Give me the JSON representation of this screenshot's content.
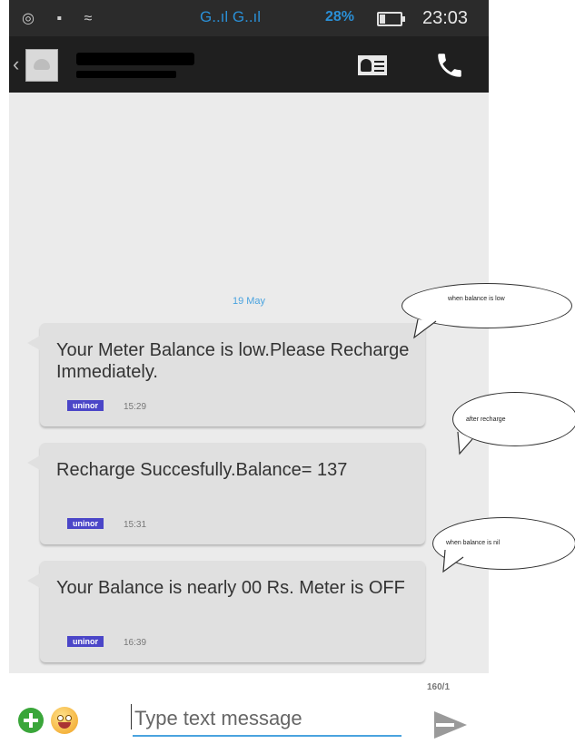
{
  "status_bar": {
    "network": "G..ıl G..ıl",
    "battery_percent": "28%",
    "battery_level": 0.28,
    "time": "23:03"
  },
  "action_bar": {
    "back_icon": "chevron-left-icon",
    "avatar_icon": "contact-avatar-icon",
    "contact_card_icon": "contact-card-icon",
    "call_icon": "phone-icon"
  },
  "chat": {
    "date_label": "19 May",
    "messages": [
      {
        "text": "Your Meter Balance is low.Please Recharge Immediately.",
        "sim": "uninor",
        "time": "15:29"
      },
      {
        "text": "Recharge Succesfully.Balance= 137",
        "sim": "uninor",
        "time": "15:31"
      },
      {
        "text": "Your Balance is nearly 00 Rs. Meter is OFF",
        "sim": "uninor",
        "time": "16:39"
      }
    ]
  },
  "composer": {
    "char_count": "160/1",
    "placeholder": "Type text message",
    "add_icon": "plus-circle-icon",
    "emoji_icon": "emoji-icon",
    "send_icon": "send-icon"
  },
  "annotations": [
    {
      "text": "when balance is low"
    },
    {
      "text": "after recharge"
    },
    {
      "text": "when balance is nil"
    }
  ],
  "colors": {
    "status_bar_bg": "#2b2b2b",
    "action_bar_bg": "#1f1f1f",
    "chat_bg": "#ebebeb",
    "bubble_bg": "#e0e0e0",
    "accent": "#4aa3df",
    "sim_badge": "#4b46c8"
  }
}
